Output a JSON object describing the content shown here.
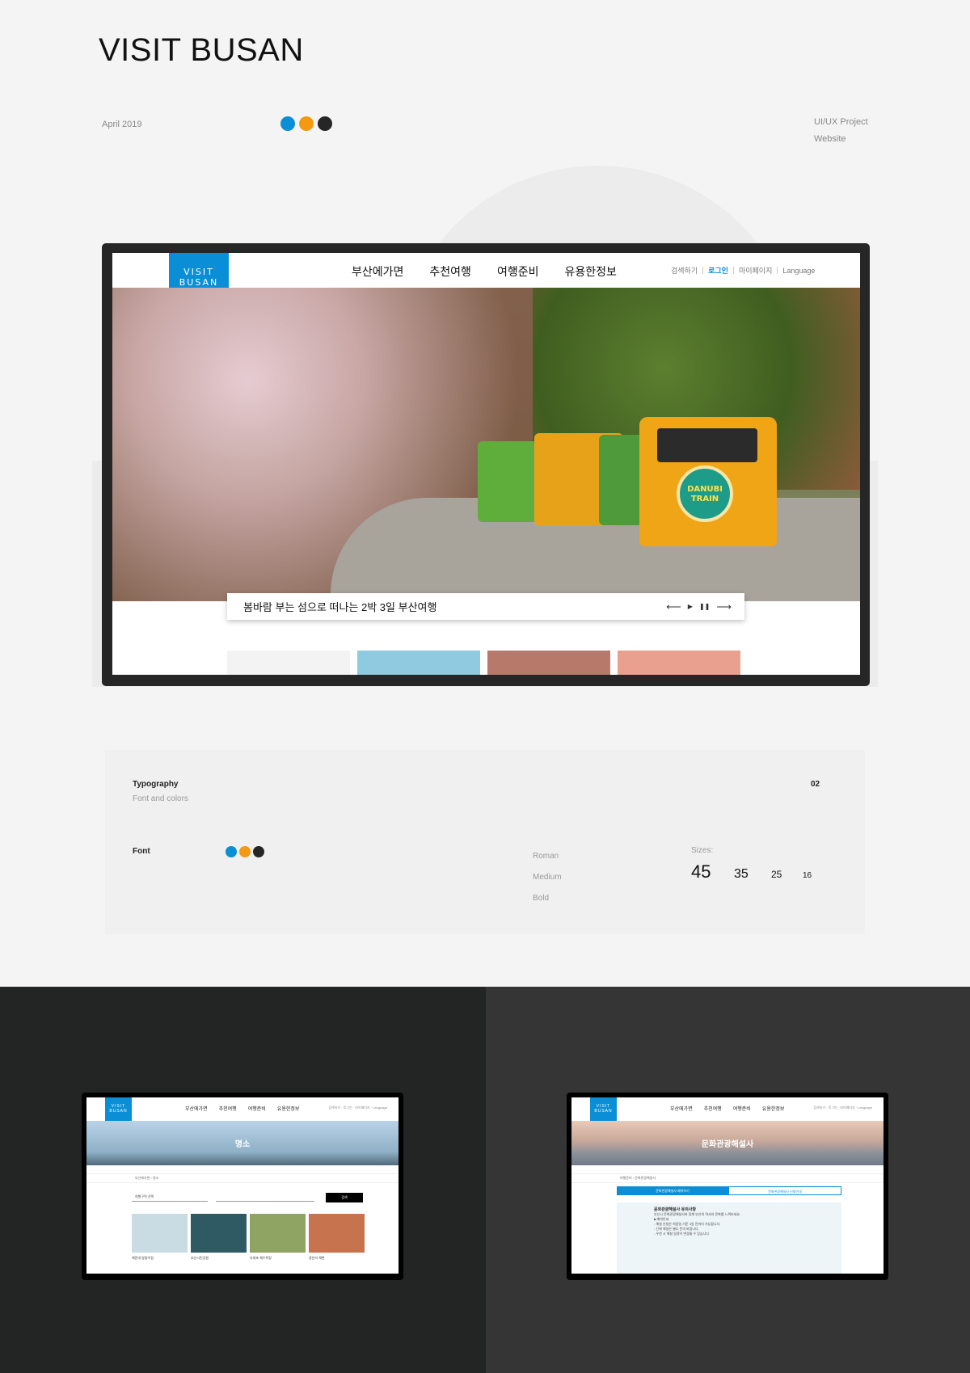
{
  "header": {
    "title": "VISIT BUSAN",
    "date": "April 2019",
    "meta_line1": "UI/UX Project",
    "meta_line2": "Website",
    "brand_colors": [
      "#0a8fd6",
      "#f39a12",
      "#262626"
    ]
  },
  "site": {
    "logo_line1": "VISIT",
    "logo_line2": "BUSAN",
    "nav": [
      "부산에가면",
      "추천여행",
      "여행준비",
      "유용한정보"
    ],
    "util": {
      "search": "검색하기",
      "login": "로그인",
      "mypage": "마이페이지",
      "language": "Language"
    },
    "train_badge_line1": "DANUBI",
    "train_badge_line2": "TRAIN",
    "hero_caption": "봄바람 부는 섬으로 떠나는 2박 3일 부산여행",
    "controls": {
      "prev": "⟵",
      "play": "▶",
      "pause": "❚❚",
      "next": "⟶"
    }
  },
  "typography": {
    "title": "Typography",
    "subtitle": "Font and colors",
    "number": "02",
    "font_label": "Font",
    "weights": [
      "Roman",
      "Medium",
      "Bold"
    ],
    "sizes_label": "Sizes:",
    "sizes": [
      "45",
      "35",
      "25",
      "16"
    ]
  },
  "mini_left": {
    "logo": "VISIT BUSAN",
    "nav": [
      "부산에가면",
      "추천여행",
      "여행준비",
      "유용한정보"
    ],
    "util": "검색하기 · 로그인 · 마이페이지 · Language",
    "hero_title": "명소",
    "breadcrumb": "부산에가면 › 명소",
    "filter": "여행구역 선택",
    "search_btn": "검색",
    "captions": [
      "해운대 달맞이길",
      "부산시민공원",
      "다대포 해수욕장",
      "광안리 해변"
    ]
  },
  "mini_right": {
    "logo": "VISIT BUSAN",
    "nav": [
      "부산에가면",
      "추천여행",
      "여행준비",
      "유용한정보"
    ],
    "util": "검색하기 · 로그인 · 마이페이지 · Language",
    "hero_title": "문화관광해설사",
    "breadcrumb": "여행준비 › 문화관광해설사",
    "tab_active": "문화관광해설사 예약하기",
    "tab_inactive": "문화관광해설사 신청안내",
    "notice_title": "문화관광해설사 유의사항",
    "notice_lines": [
      "부산시 문화관광해설사와 함께 부산의 역사와 문화를 느껴보세요.",
      "■ 예약안내",
      "- 해설 신청은 희망일 기준 3일 전까지 가능합니다.",
      "- 단체 해설은 별도 문의 바랍니다.",
      "- 우천 시 해설 일정이 변경될 수 있습니다."
    ]
  }
}
